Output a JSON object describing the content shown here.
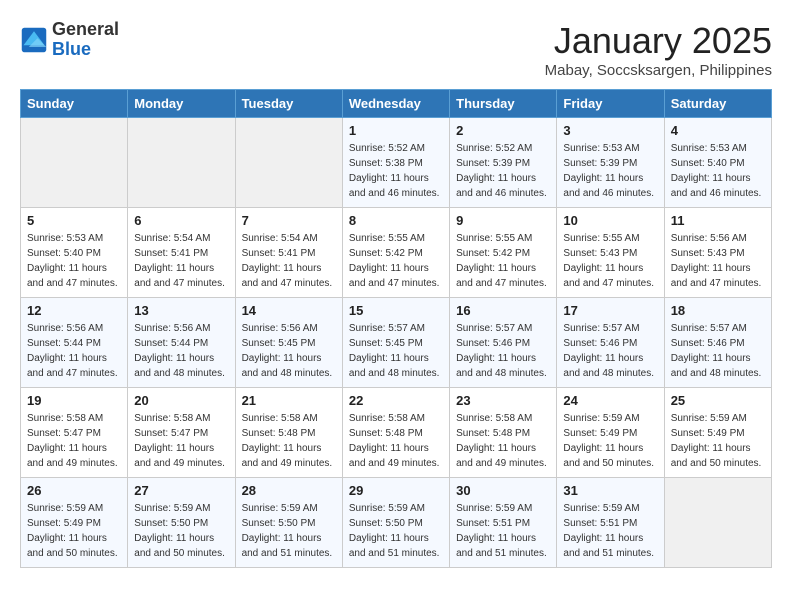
{
  "header": {
    "logo_general": "General",
    "logo_blue": "Blue",
    "month_title": "January 2025",
    "subtitle": "Mabay, Soccsksargen, Philippines"
  },
  "weekdays": [
    "Sunday",
    "Monday",
    "Tuesday",
    "Wednesday",
    "Thursday",
    "Friday",
    "Saturday"
  ],
  "weeks": [
    [
      {
        "day": "",
        "empty": true
      },
      {
        "day": "",
        "empty": true
      },
      {
        "day": "",
        "empty": true
      },
      {
        "day": "1",
        "sunrise": "5:52 AM",
        "sunset": "5:38 PM",
        "daylight": "11 hours and 46 minutes."
      },
      {
        "day": "2",
        "sunrise": "5:52 AM",
        "sunset": "5:39 PM",
        "daylight": "11 hours and 46 minutes."
      },
      {
        "day": "3",
        "sunrise": "5:53 AM",
        "sunset": "5:39 PM",
        "daylight": "11 hours and 46 minutes."
      },
      {
        "day": "4",
        "sunrise": "5:53 AM",
        "sunset": "5:40 PM",
        "daylight": "11 hours and 46 minutes."
      }
    ],
    [
      {
        "day": "5",
        "sunrise": "5:53 AM",
        "sunset": "5:40 PM",
        "daylight": "11 hours and 47 minutes."
      },
      {
        "day": "6",
        "sunrise": "5:54 AM",
        "sunset": "5:41 PM",
        "daylight": "11 hours and 47 minutes."
      },
      {
        "day": "7",
        "sunrise": "5:54 AM",
        "sunset": "5:41 PM",
        "daylight": "11 hours and 47 minutes."
      },
      {
        "day": "8",
        "sunrise": "5:55 AM",
        "sunset": "5:42 PM",
        "daylight": "11 hours and 47 minutes."
      },
      {
        "day": "9",
        "sunrise": "5:55 AM",
        "sunset": "5:42 PM",
        "daylight": "11 hours and 47 minutes."
      },
      {
        "day": "10",
        "sunrise": "5:55 AM",
        "sunset": "5:43 PM",
        "daylight": "11 hours and 47 minutes."
      },
      {
        "day": "11",
        "sunrise": "5:56 AM",
        "sunset": "5:43 PM",
        "daylight": "11 hours and 47 minutes."
      }
    ],
    [
      {
        "day": "12",
        "sunrise": "5:56 AM",
        "sunset": "5:44 PM",
        "daylight": "11 hours and 47 minutes."
      },
      {
        "day": "13",
        "sunrise": "5:56 AM",
        "sunset": "5:44 PM",
        "daylight": "11 hours and 48 minutes."
      },
      {
        "day": "14",
        "sunrise": "5:56 AM",
        "sunset": "5:45 PM",
        "daylight": "11 hours and 48 minutes."
      },
      {
        "day": "15",
        "sunrise": "5:57 AM",
        "sunset": "5:45 PM",
        "daylight": "11 hours and 48 minutes."
      },
      {
        "day": "16",
        "sunrise": "5:57 AM",
        "sunset": "5:46 PM",
        "daylight": "11 hours and 48 minutes."
      },
      {
        "day": "17",
        "sunrise": "5:57 AM",
        "sunset": "5:46 PM",
        "daylight": "11 hours and 48 minutes."
      },
      {
        "day": "18",
        "sunrise": "5:57 AM",
        "sunset": "5:46 PM",
        "daylight": "11 hours and 48 minutes."
      }
    ],
    [
      {
        "day": "19",
        "sunrise": "5:58 AM",
        "sunset": "5:47 PM",
        "daylight": "11 hours and 49 minutes."
      },
      {
        "day": "20",
        "sunrise": "5:58 AM",
        "sunset": "5:47 PM",
        "daylight": "11 hours and 49 minutes."
      },
      {
        "day": "21",
        "sunrise": "5:58 AM",
        "sunset": "5:48 PM",
        "daylight": "11 hours and 49 minutes."
      },
      {
        "day": "22",
        "sunrise": "5:58 AM",
        "sunset": "5:48 PM",
        "daylight": "11 hours and 49 minutes."
      },
      {
        "day": "23",
        "sunrise": "5:58 AM",
        "sunset": "5:48 PM",
        "daylight": "11 hours and 49 minutes."
      },
      {
        "day": "24",
        "sunrise": "5:59 AM",
        "sunset": "5:49 PM",
        "daylight": "11 hours and 50 minutes."
      },
      {
        "day": "25",
        "sunrise": "5:59 AM",
        "sunset": "5:49 PM",
        "daylight": "11 hours and 50 minutes."
      }
    ],
    [
      {
        "day": "26",
        "sunrise": "5:59 AM",
        "sunset": "5:49 PM",
        "daylight": "11 hours and 50 minutes."
      },
      {
        "day": "27",
        "sunrise": "5:59 AM",
        "sunset": "5:50 PM",
        "daylight": "11 hours and 50 minutes."
      },
      {
        "day": "28",
        "sunrise": "5:59 AM",
        "sunset": "5:50 PM",
        "daylight": "11 hours and 51 minutes."
      },
      {
        "day": "29",
        "sunrise": "5:59 AM",
        "sunset": "5:50 PM",
        "daylight": "11 hours and 51 minutes."
      },
      {
        "day": "30",
        "sunrise": "5:59 AM",
        "sunset": "5:51 PM",
        "daylight": "11 hours and 51 minutes."
      },
      {
        "day": "31",
        "sunrise": "5:59 AM",
        "sunset": "5:51 PM",
        "daylight": "11 hours and 51 minutes."
      },
      {
        "day": "",
        "empty": true
      }
    ]
  ]
}
